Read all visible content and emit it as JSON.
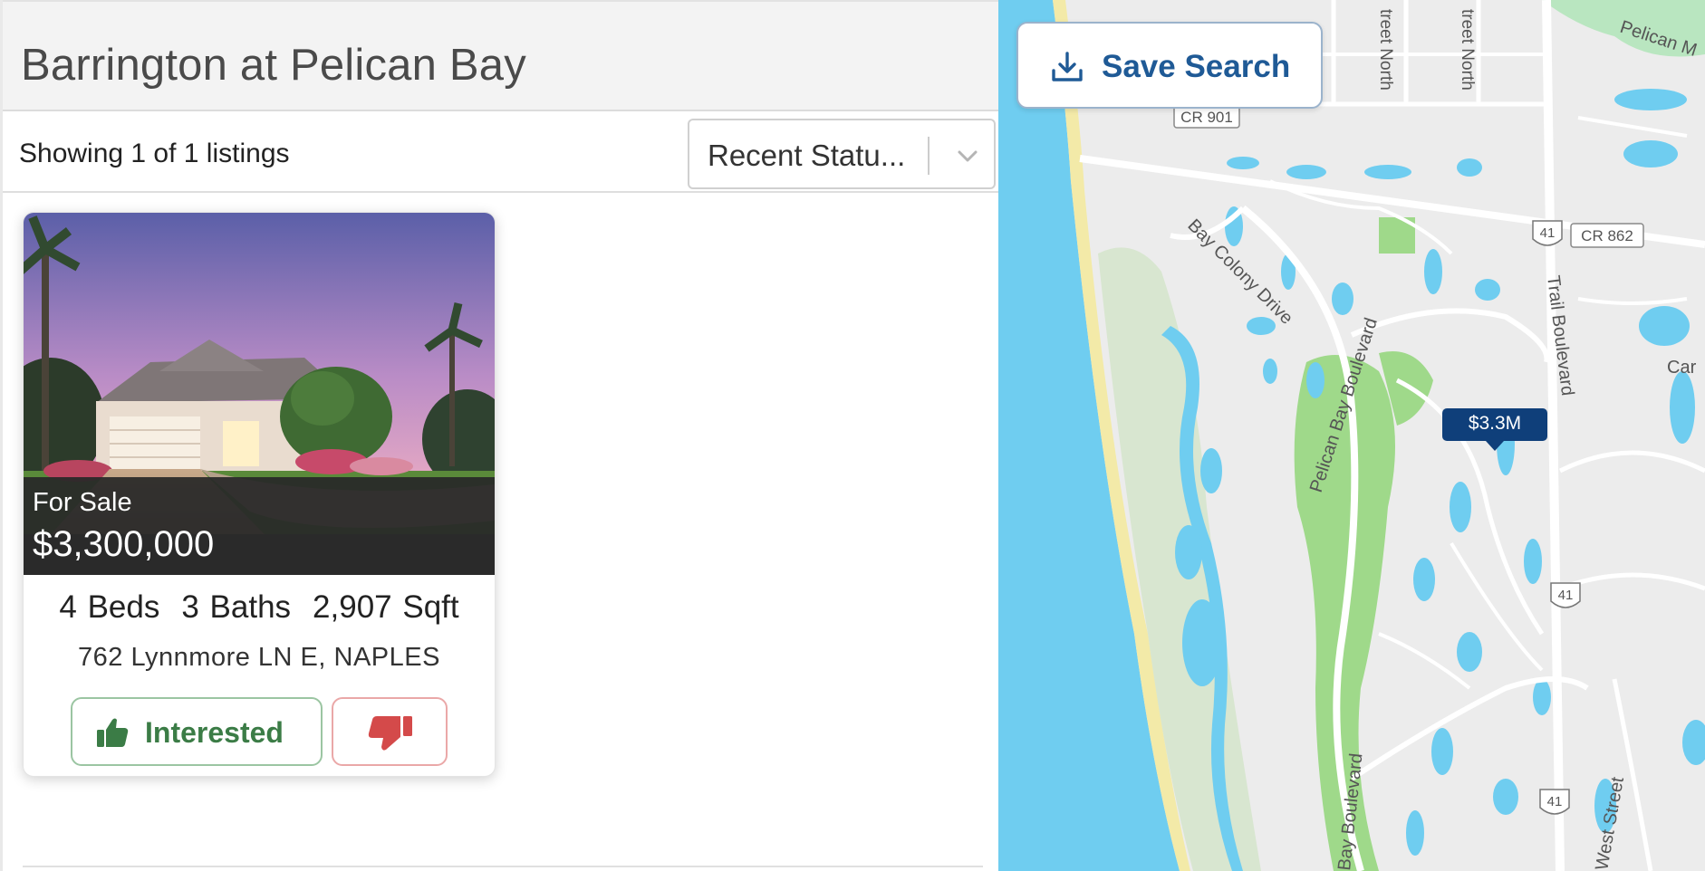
{
  "page": {
    "title": "Barrington at Pelican Bay"
  },
  "toolbar": {
    "showing_text": "Showing 1 of 1 listings",
    "sort_value": "Recent Statu..."
  },
  "listing": {
    "status": "For Sale",
    "price": "$3,300,000",
    "beds": "4 Beds",
    "baths": "3 Baths",
    "sqft": "2,907 Sqft",
    "address": "762 Lynnmore LN E, NAPLES",
    "interested_label": "Interested",
    "not_interested_icon": "thumbs-down-icon",
    "interested_icon": "thumbs-up-icon"
  },
  "map": {
    "save_search_label": "Save Search",
    "save_icon": "download-icon",
    "marker_price": "$3.3M",
    "labels": {
      "cr901": "CR 901",
      "cr862": "CR 862",
      "us41_a": "41",
      "us41_b": "41",
      "us41_c": "41",
      "bay_colony": "Bay Colony Drive",
      "pelican_bay_blvd": "Pelican Bay Boulevard",
      "trail_blvd": "Trail Boulevard",
      "bay_blvd": "Bay Boulevard",
      "west_street": "West Street",
      "pelican_m": "Pelican M",
      "car": "Car",
      "street_north_1": "treet North",
      "street_north_2": "treet North"
    }
  },
  "colors": {
    "water": "#6fcdf0",
    "land": "#ececec",
    "green": "#9fd98a",
    "beach": "#f3eaa8",
    "marker": "#0f3f7a",
    "interested": "#3b7c46",
    "dislike": "#d44a4a",
    "save": "#1f5a96"
  }
}
